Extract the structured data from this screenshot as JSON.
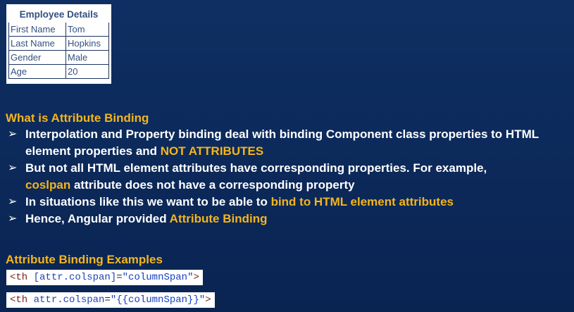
{
  "employee_table": {
    "title": "Employee Details",
    "rows": [
      {
        "key": "First Name",
        "value": "Tom"
      },
      {
        "key": "Last Name",
        "value": "Hopkins"
      },
      {
        "key": "Gender",
        "value": "Male"
      },
      {
        "key": "Age",
        "value": "20"
      }
    ]
  },
  "section": {
    "heading": "What is Attribute Binding",
    "bullet1_text": "Interpolation and  Property binding deal with binding Component class properties to HTML element properties and ",
    "bullet1_highlight": "NOT ATTRIBUTES",
    "bullet2_text": "But not all HTML element attributes have corresponding properties. For example,",
    "bullet2_highlight": "coslpan",
    "bullet2_rest": " attribute does not have a corresponding property",
    "bullet3_text": "In situations like this we want to be able to ",
    "bullet3_highlight": "bind to HTML element attributes",
    "bullet4_text": "Hence, Angular provided ",
    "bullet4_highlight": "Attribute Binding",
    "arrow_glyph": "➢"
  },
  "examples": {
    "heading": "Attribute Binding  Examples",
    "code1": {
      "tag_open": "<th",
      "attr": " [attr.colspan]",
      "eq": "=",
      "value": "\"columnSpan\"",
      "tag_close": ">"
    },
    "code2": {
      "tag_open": "<th",
      "attr": " attr.colspan",
      "eq": "=",
      "value": "\"{{columnSpan}}\"",
      "tag_close": ">"
    }
  },
  "colors": {
    "background": "#0c2a5b",
    "highlight": "#f5b51c",
    "table_text": "#34507f"
  }
}
